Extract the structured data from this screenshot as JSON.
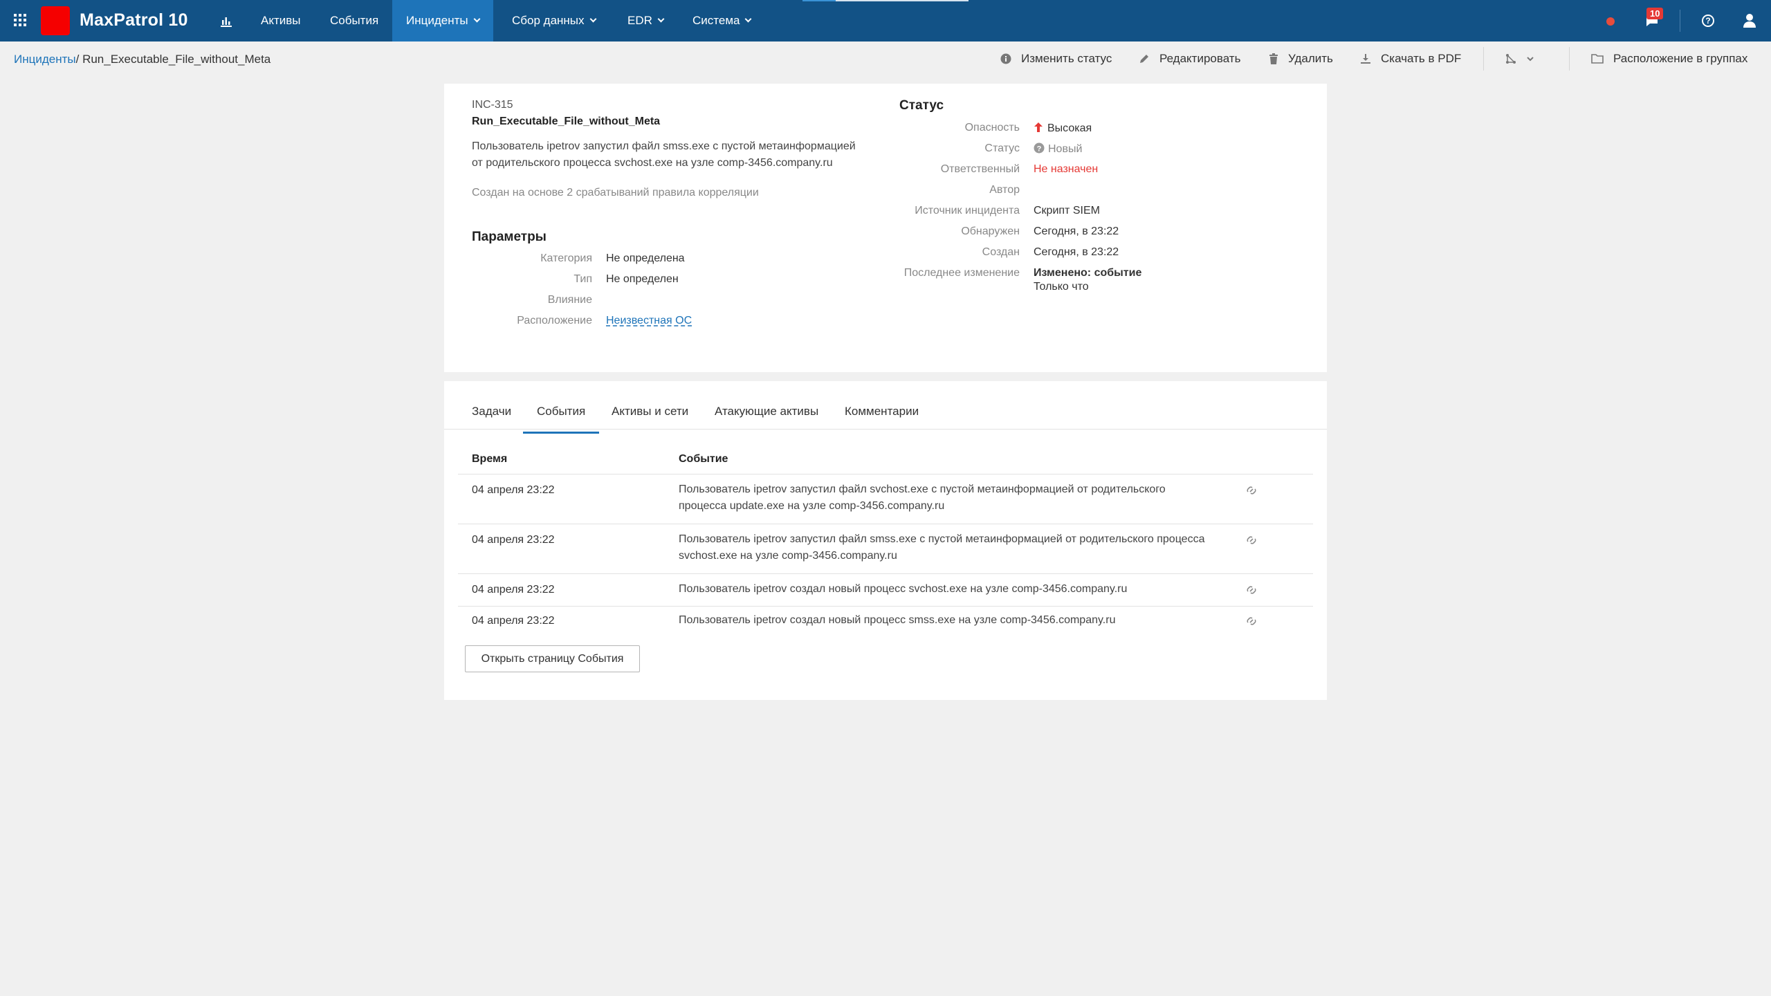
{
  "app": {
    "brand": "MaxPatrol 10",
    "accent": "#125286",
    "active_nav": "#1e74b9",
    "logo_color": "#f50000"
  },
  "nav": {
    "items": [
      {
        "label": "Активы"
      },
      {
        "label": "События"
      },
      {
        "label": "Инциденты"
      },
      {
        "label": "Сбор данных"
      },
      {
        "label": "EDR"
      },
      {
        "label": "Система"
      }
    ],
    "notifications_count": "10"
  },
  "breadcrumb": {
    "root": "Инциденты",
    "separator": "/",
    "current": "Run_Executable_File_without_Meta"
  },
  "toolbar": {
    "change_status": "Изменить статус",
    "edit": "Редактировать",
    "delete": "Удалить",
    "download_pdf": "Скачать в PDF",
    "groups": "Расположение в группах"
  },
  "incident": {
    "id": "INC-315",
    "name": "Run_Executable_File_without_Meta",
    "description_lines": [
      "Пользователь ipetrov запустил файл smss.exe с пустой метаинформацией",
      "от родительского процесса svchost.exe на узле comp-3456.company.ru"
    ],
    "created_note": "Создан на основе 2 срабатываний правила корреляции",
    "params_title": "Параметры",
    "params": [
      {
        "key": "Категория",
        "value": "Не определена"
      },
      {
        "key": "Тип",
        "value": "Не определен"
      },
      {
        "key": "Влияние",
        "value": ""
      },
      {
        "key": "Расположение",
        "value": "Неизвестная ОС"
      }
    ],
    "status_title": "Статус",
    "status": [
      {
        "key": "Опасность",
        "value": "Высокая"
      },
      {
        "key": "Статус",
        "value": "Новый"
      },
      {
        "key": "Ответственный",
        "value": "Не назначен"
      },
      {
        "key": "Автор",
        "value": ""
      },
      {
        "key": "Источник инцидента",
        "value": "Скрипт SIEM"
      },
      {
        "key": "Обнаружен",
        "value": "Сегодня, в 23:22"
      },
      {
        "key": "Создан",
        "value": "Сегодня, в 23:22"
      },
      {
        "key": "Последнее изменение",
        "value": "Изменено: событие",
        "value2": "Только что"
      }
    ]
  },
  "tabs": [
    {
      "label": "Задачи"
    },
    {
      "label": "События"
    },
    {
      "label": "Активы и сети"
    },
    {
      "label": "Атакующие активы"
    },
    {
      "label": "Комментарии"
    }
  ],
  "events": {
    "columns": [
      "Время",
      "Событие"
    ],
    "rows": [
      {
        "time": "04 апреля 23:22",
        "lines": [
          "Пользователь ipetrov запустил файл svchost.exe с пустой метаинформацией от родительского",
          "процесса update.exe на узле comp-3456.company.ru"
        ]
      },
      {
        "time": "04 апреля 23:22",
        "lines": [
          "Пользователь ipetrov запустил файл smss.exe с пустой метаинформацией от родительского процесса",
          "svchost.exe на узле comp-3456.company.ru"
        ]
      },
      {
        "time": "04 апреля 23:22",
        "lines": [
          "Пользователь ipetrov создал новый процесс svchost.exe на узле comp-3456.company.ru"
        ]
      },
      {
        "time": "04 апреля 23:22",
        "lines": [
          "Пользователь ipetrov создал новый процесс smss.exe на узле comp-3456.company.ru"
        ]
      }
    ],
    "open_button": "Открыть страницу События"
  }
}
